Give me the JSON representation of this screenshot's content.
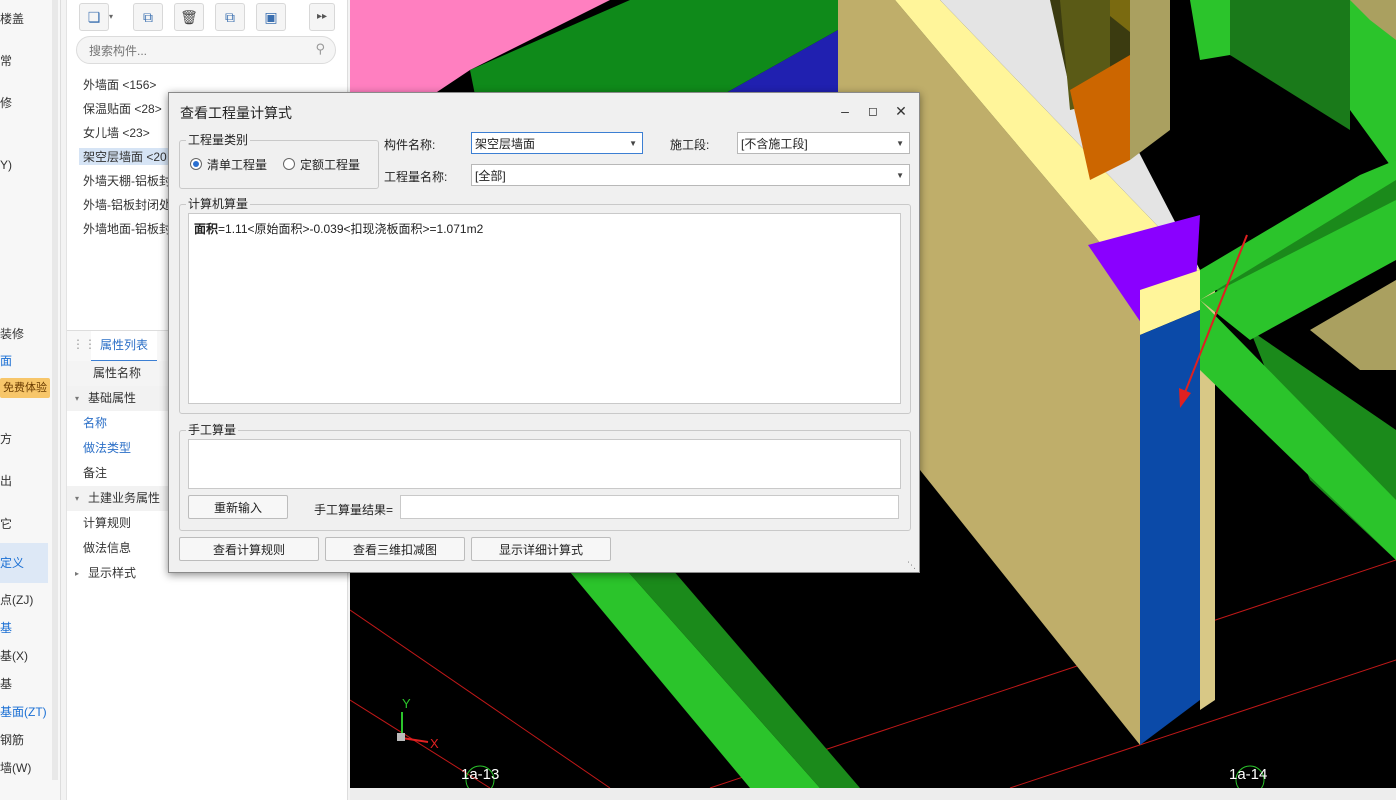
{
  "left_sidebar": {
    "items": [
      "楼盖",
      "常",
      "修",
      "Y)",
      "装修",
      "面",
      "方",
      "出",
      "它",
      "定义",
      "点(ZJ)",
      "基",
      "基(X)",
      "基",
      "基面(ZT)",
      "钢筋",
      "墙(W)"
    ],
    "free_badge": "免费体验"
  },
  "component_panel": {
    "search_placeholder": "搜索构件...",
    "items": [
      "外墙面 <156>",
      "保温贴面 <28>",
      "女儿墙 <23>",
      "架空层墙面 <20",
      "外墙天棚-铝板封",
      "外墙-铝板封闭处",
      "外墙地面-铝板封"
    ],
    "selected_index": 3
  },
  "properties": {
    "tab_label": "属性列表",
    "header": "属性名称",
    "rows": [
      {
        "label": "基础属性",
        "kind": "group"
      },
      {
        "label": "名称",
        "kind": "link"
      },
      {
        "label": "做法类型",
        "kind": "link"
      },
      {
        "label": "备注",
        "kind": "plain"
      },
      {
        "label": "土建业务属性",
        "kind": "group"
      },
      {
        "label": "计算规则",
        "kind": "plain"
      },
      {
        "label": "做法信息",
        "kind": "plain"
      },
      {
        "label": "显示样式",
        "kind": "group-collapsed"
      }
    ]
  },
  "dialog": {
    "title": "查看工程量计算式",
    "qty_type": {
      "legend": "工程量类别",
      "option_bill": "清单工程量",
      "option_quota": "定额工程量",
      "selected": "清单工程量"
    },
    "component_name_label": "构件名称:",
    "component_name_value": "架空层墙面",
    "stage_label": "施工段:",
    "stage_value": "[不含施工段]",
    "qty_name_label": "工程量名称:",
    "qty_name_value": "[全部]",
    "computer_calc": {
      "legend": "计算机算量",
      "formula_head": "面积",
      "formula_body": "=1.11<原始面积>-0.039<扣现浇板面积>=1.071m2"
    },
    "manual_calc": {
      "legend": "手工算量",
      "reinput_button": "重新输入",
      "result_label": "手工算量结果="
    },
    "buttons": {
      "view_rules": "查看计算规则",
      "view_3d": "查看三维扣减图",
      "show_detail": "显示详细计算式"
    }
  },
  "viewport": {
    "axis_labels": {
      "y": "Y",
      "x": "X"
    },
    "grid_labels": [
      "1a-13",
      "1a-14"
    ]
  }
}
